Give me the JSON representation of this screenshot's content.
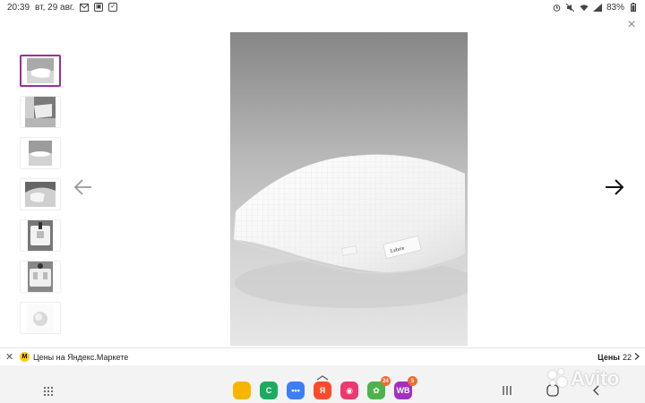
{
  "status_bar": {
    "time": "20:39",
    "date": "вт, 29 авг.",
    "battery": "83%",
    "icons": [
      "gmail-icon",
      "photos-icon",
      "message-icon",
      "alarm-icon",
      "mute-icon",
      "wifi-icon",
      "signal-icon",
      "battery-icon"
    ]
  },
  "gallery": {
    "close_label": "×",
    "thumbnails": [
      {
        "name": "thumb-pillow-front",
        "active": true
      },
      {
        "name": "thumb-pillow-bed"
      },
      {
        "name": "thumb-pillow-side"
      },
      {
        "name": "thumb-pillow-hand"
      },
      {
        "name": "thumb-pillow-tag"
      },
      {
        "name": "thumb-pillow-label"
      },
      {
        "name": "thumb-pillow-fill"
      }
    ],
    "main_image": {
      "label_brand": "Lebrre"
    },
    "prev_icon": "arrow-left-icon",
    "next_icon": "arrow-right-icon"
  },
  "market_bar": {
    "close_label": "✕",
    "logo": "М",
    "title": "Цены на Яндекс.Маркете",
    "prices_label": "Цены",
    "prices_count": "22"
  },
  "nav_bar": {
    "apps": [
      {
        "name": "files-app-icon",
        "color": "#f7b500",
        "glyph": ""
      },
      {
        "name": "phone-app-icon",
        "color": "#1dab5f",
        "glyph": "C"
      },
      {
        "name": "messages-app-icon",
        "color": "#3d7ef5",
        "glyph": "•••"
      },
      {
        "name": "yandex-app-icon",
        "color": "#ff4a2b",
        "glyph": "Я"
      },
      {
        "name": "screen-recorder-app-icon",
        "color": "#ec3a6e",
        "glyph": "◉"
      },
      {
        "name": "chat-app-icon",
        "color": "#4db34d",
        "glyph": "✿",
        "badge": "24"
      },
      {
        "name": "wildberries-app-icon",
        "color": "#a32fbf",
        "glyph": "WB",
        "badge": "5"
      }
    ]
  },
  "watermark": {
    "text": "Avito"
  },
  "colors": {
    "accent": "#9b2f9b",
    "badge": "#f26b2e"
  }
}
